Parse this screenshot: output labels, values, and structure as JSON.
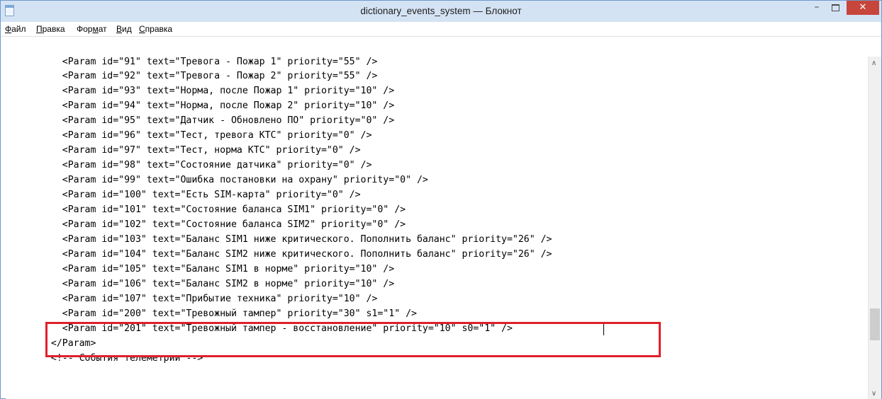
{
  "window": {
    "title": "dictionary_events_system — Блокнот",
    "controls": {
      "minimize": "–",
      "close": "✕"
    }
  },
  "menu": [
    {
      "underline": "Ф",
      "rest": "айл"
    },
    {
      "underline": "П",
      "rest": "равка"
    },
    {
      "pre": "Фор",
      "underline": "м",
      "rest": "ат"
    },
    {
      "underline": "В",
      "rest": "ид"
    },
    {
      "underline": "С",
      "rest": "правка"
    }
  ],
  "lines": [
    "    <Param id=\"91\" text=\"Тревога - Пожар 1\" priority=\"55\" />",
    "    <Param id=\"92\" text=\"Тревога - Пожар 2\" priority=\"55\" />",
    "    <Param id=\"93\" text=\"Норма, после Пожар 1\" priority=\"10\" />",
    "    <Param id=\"94\" text=\"Норма, после Пожар 2\" priority=\"10\" />",
    "    <Param id=\"95\" text=\"Датчик - Обновлено ПО\" priority=\"0\" />",
    "    <Param id=\"96\" text=\"Тест, тревога КТС\" priority=\"0\" />",
    "    <Param id=\"97\" text=\"Тест, норма КТС\" priority=\"0\" />",
    "    <Param id=\"98\" text=\"Состояние датчика\" priority=\"0\" />",
    "    <Param id=\"99\" text=\"Ошибка постановки на охрану\" priority=\"0\" />",
    "    <Param id=\"100\" text=\"Есть SIM-карта\" priority=\"0\" />",
    "    <Param id=\"101\" text=\"Состояние баланса SIM1\" priority=\"0\" />",
    "    <Param id=\"102\" text=\"Состояние баланса SIM2\" priority=\"0\" />",
    "    <Param id=\"103\" text=\"Баланс SIM1 ниже критического. Пополнить баланс\" priority=\"26\" />",
    "    <Param id=\"104\" text=\"Баланс SIM2 ниже критического. Пополнить баланс\" priority=\"26\" />",
    "    <Param id=\"105\" text=\"Баланс SIM1 в норме\" priority=\"10\" />",
    "    <Param id=\"106\" text=\"Баланс SIM2 в норме\" priority=\"10\" />",
    "    <Param id=\"107\" text=\"Прибытие техника\" priority=\"10\" />",
    "    <Param id=\"200\" text=\"Тревожный тампер\" priority=\"30\" s1=\"1\" />",
    "    <Param id=\"201\" text=\"Тревожный тампер - восстановление\" priority=\"10\" s0=\"1\" />",
    "  </Param>",
    "  <!-- События телеметрии -->"
  ],
  "caret": {
    "line": 18,
    "column": 80
  },
  "highlight": {
    "first_line": 17,
    "last_line": 18,
    "color": "#e0202a"
  },
  "colors": {
    "titlebar": "#d4e3f4",
    "close_button": "#c7463c"
  }
}
